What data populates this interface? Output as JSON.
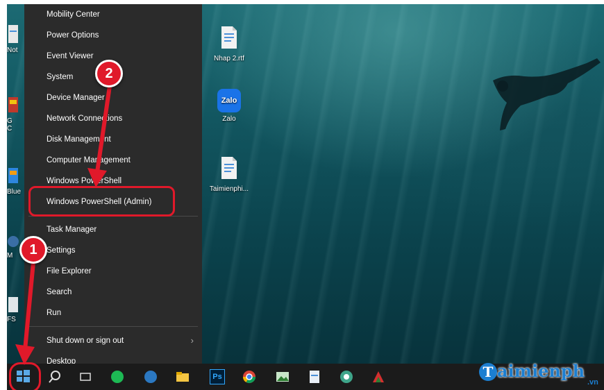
{
  "desktop": {
    "icons": [
      {
        "label": "Nhap 2.rtf",
        "icon": "document-icon"
      },
      {
        "label": "Zalo",
        "icon": "zalo-icon",
        "badge": "Zalo"
      },
      {
        "label": "Taimienphi...",
        "icon": "document-icon"
      }
    ],
    "left_edge_labels": [
      "Not",
      "G",
      "C",
      "Blue",
      "M",
      "FS"
    ]
  },
  "context_menu": {
    "items": [
      {
        "label": "Mobility Center"
      },
      {
        "label": "Power Options"
      },
      {
        "label": "Event Viewer"
      },
      {
        "label": "System"
      },
      {
        "label": "Device Manager"
      },
      {
        "label": "Network Connections"
      },
      {
        "label": "Disk Management"
      },
      {
        "label": "Computer Management"
      },
      {
        "label": "Windows PowerShell"
      },
      {
        "label": "Windows PowerShell (Admin)"
      },
      {
        "label": "Task Manager"
      },
      {
        "label": "Settings"
      },
      {
        "label": "File Explorer"
      },
      {
        "label": "Search"
      },
      {
        "label": "Run"
      },
      {
        "label": "Shut down or sign out"
      },
      {
        "label": "Desktop"
      }
    ],
    "submenu_chevron": "chevron-right-icon"
  },
  "annotations": {
    "step1": "1",
    "step2": "2",
    "color": "#e0192a"
  },
  "taskbar": {
    "photoshop_label": "Ps",
    "icons": [
      "windows-start-icon",
      "search-icon",
      "task-view-icon",
      "spotify-icon",
      "app-icon",
      "file-explorer-icon",
      "photoshop-icon",
      "chrome-icon",
      "image-icon",
      "document-icon",
      "refresh-icon",
      "app-icon"
    ]
  },
  "watermark": {
    "text": "aimienph",
    "initial": "T",
    "sub": ".vn"
  }
}
